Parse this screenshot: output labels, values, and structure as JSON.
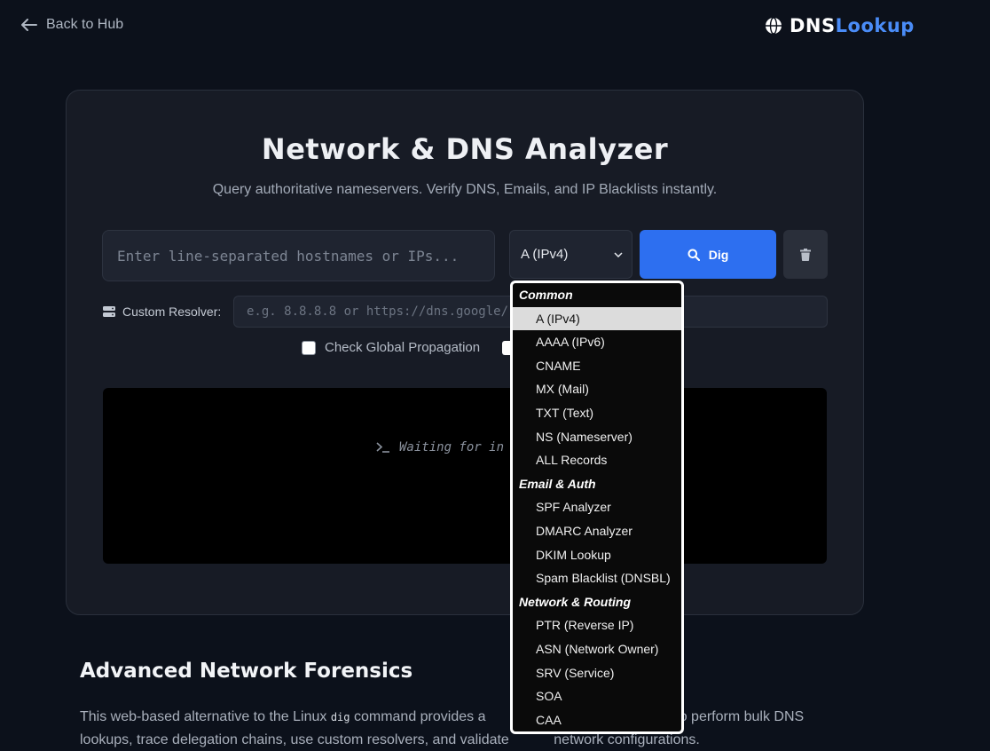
{
  "nav": {
    "back_label": "Back to Hub"
  },
  "brand": {
    "part1": "DNS",
    "part2": "Lookup"
  },
  "header": {
    "title": "Network & DNS Analyzer",
    "subtitle": "Query authoritative nameservers. Verify DNS, Emails, and IP Blacklists instantly."
  },
  "query": {
    "host_placeholder": "Enter line-separated hostnames or IPs...",
    "record_type_selected": "A (IPv4)",
    "dig_label": "Dig"
  },
  "resolver": {
    "label": "Custom Resolver:",
    "placeholder": "e.g. 8.8.8.8 or https://dns.google/r"
  },
  "options": {
    "propagation_label": "Check Global Propagation"
  },
  "terminal": {
    "waiting_text": "Waiting for in"
  },
  "dropdown": {
    "groups": [
      {
        "label": "Common",
        "options": [
          "A (IPv4)",
          "AAAA (IPv6)",
          "CNAME",
          "MX (Mail)",
          "TXT (Text)",
          "NS (Nameserver)",
          "ALL Records"
        ]
      },
      {
        "label": "Email & Auth",
        "options": [
          "SPF Analyzer",
          "DMARC Analyzer",
          "DKIM Lookup",
          "Spam Blacklist (DNSBL)"
        ]
      },
      {
        "label": "Network & Routing",
        "options": [
          "PTR (Reverse IP)",
          "ASN (Network Owner)",
          "SRV (Service)",
          "SOA",
          "CAA"
        ]
      }
    ]
  },
  "section": {
    "title": "Advanced Network Forensics",
    "text_pre": "This web-based alternative to the Linux ",
    "text_code": "dig",
    "text_mid": " command provides a",
    "text_right": "rs to perform bulk DNS",
    "text_line2a": "lookups, trace delegation chains, use custom resolvers, and validate ",
    "text_line2b": "network configurations."
  },
  "colors": {
    "accent": "#2d6ff0",
    "brand_accent": "#4a8cf7",
    "background": "#0c111b"
  }
}
